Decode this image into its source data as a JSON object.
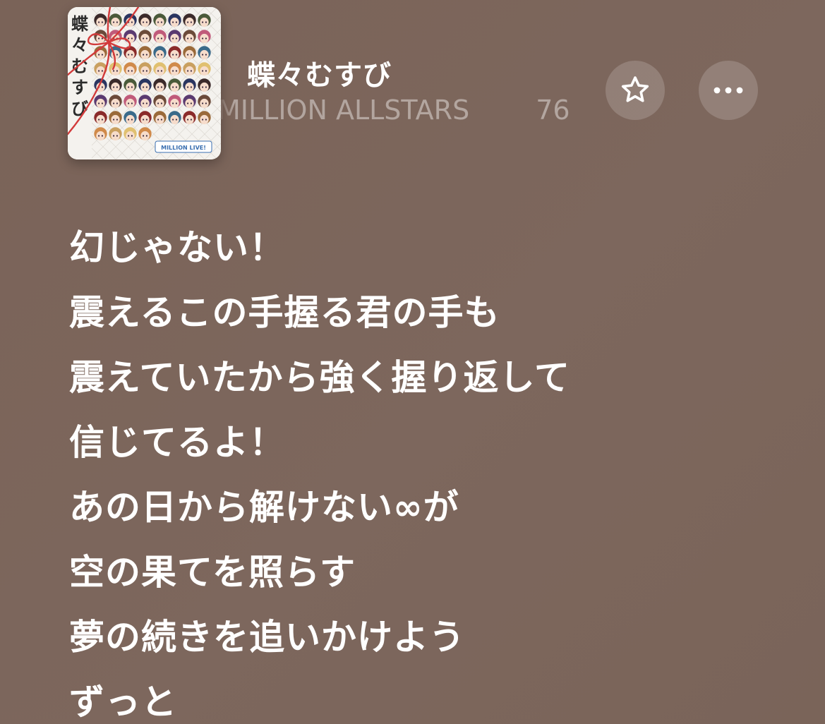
{
  "now_playing": {
    "artwork": {
      "icon": "album-artwork",
      "title_glyphs": [
        "蝶",
        "々",
        "む",
        "す",
        "び"
      ],
      "label_text": "MILLION LIVE!",
      "colors": {
        "background": "#f4f2ee",
        "ribbon": "#d23a3a",
        "portrait_hair": [
          "#3b2a2a",
          "#6b4a3a",
          "#9a6a3a",
          "#c9a060",
          "#2a3560",
          "#5a3a70",
          "#8a2a2a",
          "#d08a4a",
          "#4a5a3a",
          "#c05a7a",
          "#3a6a8a",
          "#e0c070"
        ]
      }
    },
    "title": "蝶々むすび",
    "artist": "MILLION ALLSTARS",
    "extra_text": "76",
    "favorite_button": {
      "icon": "star-outline-icon"
    },
    "more_button": {
      "icon": "ellipsis-icon"
    }
  },
  "lyrics": [
    "幻じゃない！",
    "震えるこの手握る君の手も",
    "震えていたから強く握り返して",
    "信じてるよ！",
    "あの日から解けない∞が",
    "空の果てを照らす",
    "夢の続きを追いかけよう",
    "ずっと"
  ],
  "colors": {
    "background": "#7b655a",
    "text_primary": "#ffffff",
    "text_secondary": "rgba(255,255,255,0.42)",
    "button_fill": "rgba(255,255,255,0.17)"
  }
}
